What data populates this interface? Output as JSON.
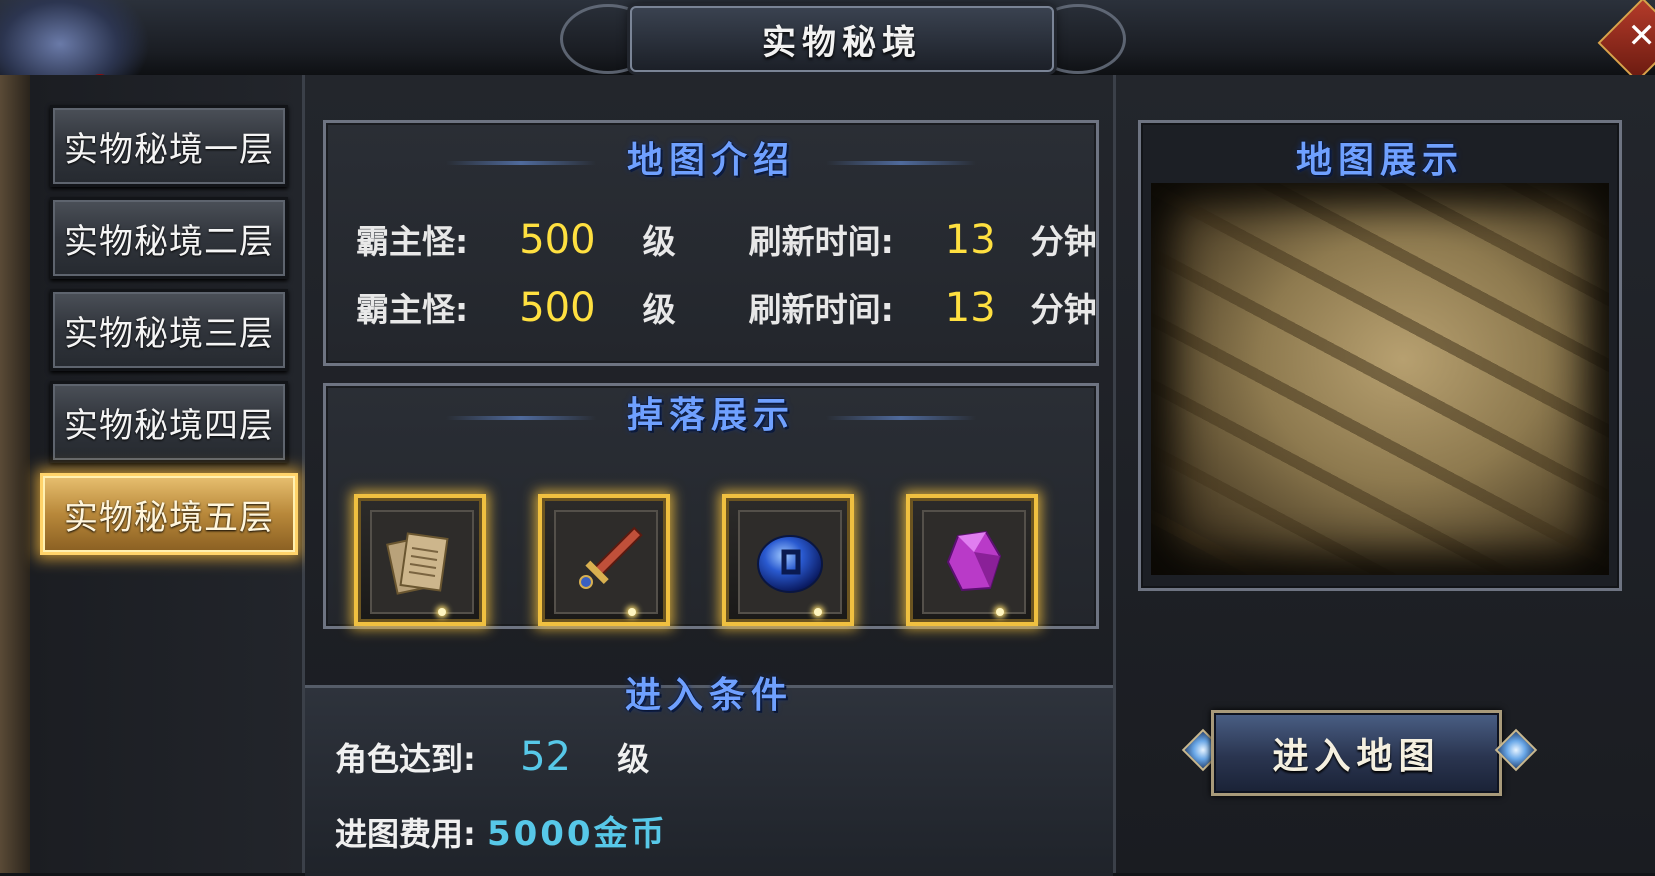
{
  "window": {
    "title": "实物秘境",
    "close_label": "✕"
  },
  "nav": {
    "items": [
      {
        "label": "实物秘境一层",
        "active": false
      },
      {
        "label": "实物秘境二层",
        "active": false
      },
      {
        "label": "实物秘境三层",
        "active": false
      },
      {
        "label": "实物秘境四层",
        "active": false
      },
      {
        "label": "实物秘境五层",
        "active": true
      }
    ]
  },
  "intro": {
    "title": "地图介绍",
    "rows": [
      {
        "boss_label": "霸主怪:",
        "boss_level": "500",
        "level_unit": "级",
        "refresh_label": "刷新时间:",
        "refresh_value": "13",
        "refresh_unit": "分钟"
      },
      {
        "boss_label": "霸主怪:",
        "boss_level": "500",
        "level_unit": "级",
        "refresh_label": "刷新时间:",
        "refresh_value": "13",
        "refresh_unit": "分钟"
      }
    ]
  },
  "drops": {
    "title": "掉落展示",
    "items": [
      {
        "icon": "scroll-papers-icon"
      },
      {
        "icon": "sword-icon"
      },
      {
        "icon": "blue-orb-icon"
      },
      {
        "icon": "purple-gem-icon"
      }
    ]
  },
  "conditions": {
    "title": "进入条件",
    "level_label": "角色达到:",
    "level_value": "52",
    "level_unit": "级",
    "cost_label": "进图费用:",
    "cost_value": "5000金币"
  },
  "map": {
    "title": "地图展示",
    "enter_button": "进入地图"
  },
  "colors": {
    "accent_gold": "#f0c040",
    "level_yellow": "#ffe040",
    "condition_cyan": "#57c8e8",
    "title_blue": "#6fa0ff"
  }
}
